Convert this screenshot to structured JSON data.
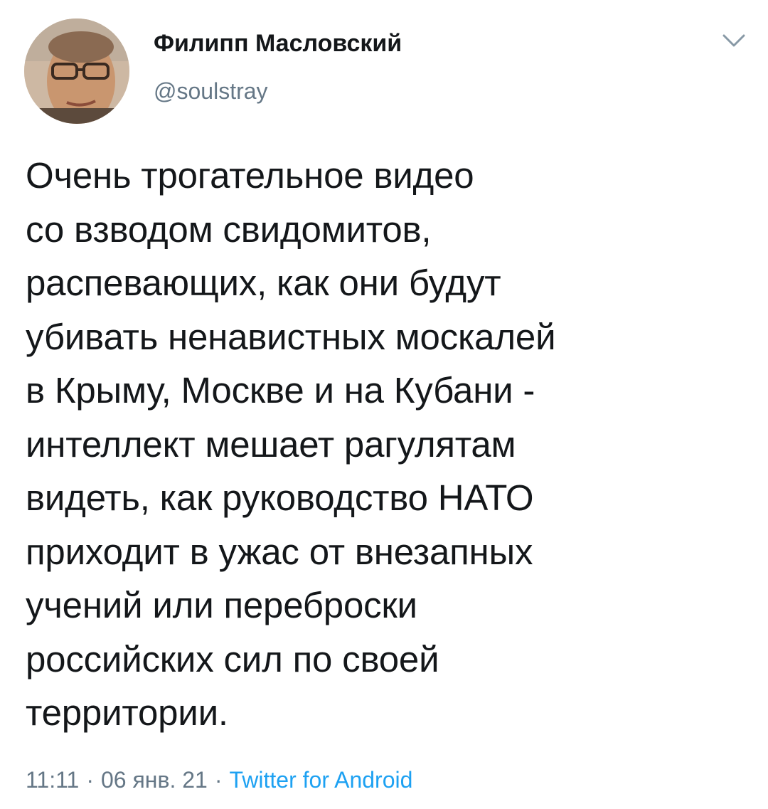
{
  "tweet": {
    "author": {
      "display_name": "Филипп Масловский",
      "handle": "@soulstray"
    },
    "text": "Очень трогательное видео\nсо взводом свидомитов,\nраспевающих, как они будут\nубивать ненавистных москалей\nв Крыму, Москве и на Кубани -\nинтеллект мешает рагулятам\nвидеть, как руководство НАТО\nприходит в ужас от внезапных\nучений или переброски\nроссийских сил по своей\nтерритории.",
    "time": "11:11",
    "date": "06 янв. 21",
    "separator": "·",
    "source": "Twitter for Android",
    "menu_icon": "chevron-down-icon",
    "colors": {
      "text": "#14171a",
      "secondary": "#657786",
      "link": "#1da1f2"
    }
  }
}
